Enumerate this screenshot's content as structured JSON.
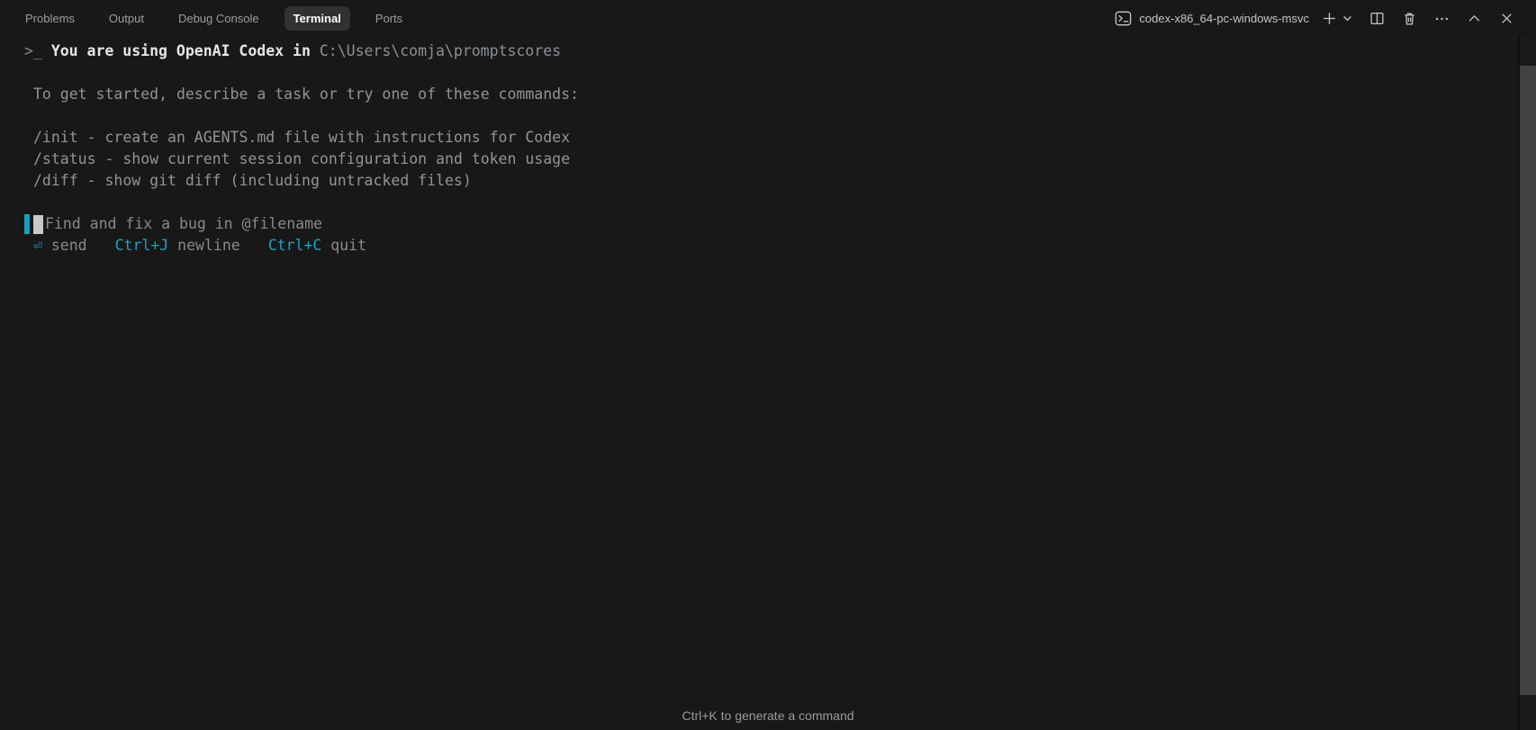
{
  "panel": {
    "tabs": [
      {
        "label": "Problems"
      },
      {
        "label": "Output"
      },
      {
        "label": "Debug Console"
      },
      {
        "label": "Terminal",
        "active": true
      },
      {
        "label": "Ports"
      }
    ]
  },
  "terminal_header": {
    "title": "codex-x86_64-pc-windows-msvc",
    "icons": [
      "terminal-prompt-icon",
      "new-terminal-plus-icon",
      "launch-profile-chevron-down-icon",
      "split-terminal-icon",
      "kill-terminal-trash-icon",
      "more-actions-ellipsis-icon",
      "maximize-panel-chevron-up-icon",
      "close-panel-x-icon"
    ]
  },
  "terminal": {
    "welcome": {
      "prefix": ">_ ",
      "bold": "You are using OpenAI Codex in ",
      "path": "C:\\Users\\comja\\promptscores"
    },
    "intro": "To get started, describe a task or try one of these commands:",
    "commands": [
      "/init - create an AGENTS.md file with instructions for Codex",
      "/status - show current session configuration and token usage",
      "/diff - show git diff (including untracked files)"
    ],
    "composer": {
      "placeholder": "Find and fix a bug in @filename"
    },
    "hints": [
      {
        "key": "⏎",
        "label": " send"
      },
      {
        "key": "Ctrl+J",
        "label": " newline"
      },
      {
        "key": "Ctrl+C",
        "label": " quit"
      }
    ],
    "bottom_hint": "Ctrl+K to generate a command"
  },
  "colors": {
    "background": "#181818",
    "accent_cyan": "#14a0c2",
    "text_dim": "#949494",
    "text_bright": "#e6e6e6",
    "cursor_block": "#c9c9c9",
    "scrollbar_thumb": "#424245"
  }
}
